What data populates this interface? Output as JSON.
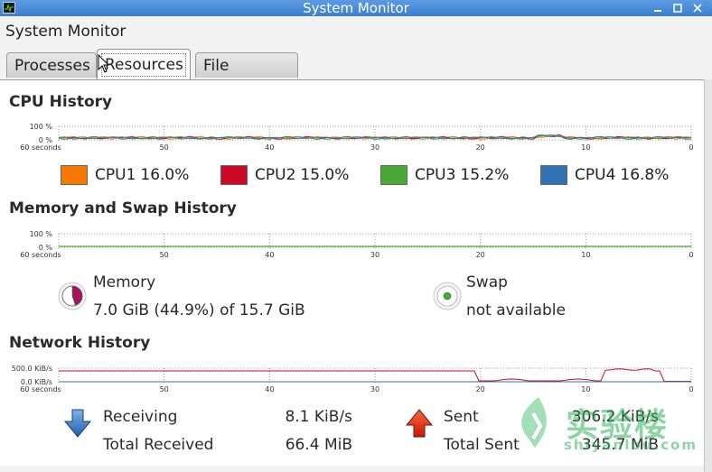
{
  "window": {
    "title": "System Monitor"
  },
  "menubar": {
    "app_name": "System Monitor"
  },
  "tabs": [
    {
      "label": "Processes",
      "active": false
    },
    {
      "label": "Resources",
      "active": true
    },
    {
      "label": "File Systems",
      "active": false
    }
  ],
  "cpu": {
    "title": "CPU History",
    "y_labels": [
      "100 %",
      "0 %"
    ],
    "x_labels": [
      "60 seconds",
      "50",
      "40",
      "30",
      "20",
      "10",
      "0"
    ],
    "legend": [
      {
        "name": "CPU1",
        "value": "16.0%",
        "color": "#f57900"
      },
      {
        "name": "CPU2",
        "value": "15.0%",
        "color": "#cc0a28"
      },
      {
        "name": "CPU3",
        "value": "15.2%",
        "color": "#4aa934"
      },
      {
        "name": "CPU4",
        "value": "16.8%",
        "color": "#2f72b4"
      }
    ]
  },
  "memory": {
    "title": "Memory and Swap History",
    "y_labels": [
      "100 %",
      "0 %"
    ],
    "x_labels": [
      "60 seconds",
      "50",
      "40",
      "30",
      "20",
      "10",
      "0"
    ],
    "memory_label": "Memory",
    "memory_value": "7.0 GiB (44.9%) of 15.7 GiB",
    "memory_fraction": 0.449,
    "memory_color": "#a4165c",
    "swap_label": "Swap",
    "swap_value": "not available",
    "swap_color": "#4aa934"
  },
  "network": {
    "title": "Network History",
    "y_labels": [
      "500.0 KiB/s",
      "0.0 KiB/s"
    ],
    "x_labels": [
      "60 seconds",
      "50",
      "40",
      "30",
      "20",
      "10",
      "0"
    ],
    "receiving_label": "Receiving",
    "receiving_value": "8.1 KiB/s",
    "total_received_label": "Total Received",
    "total_received_value": "66.4 MiB",
    "sent_label": "Sent",
    "sent_value": "306.2 KiB/s",
    "total_sent_label": "Total Sent",
    "total_sent_value": "345.7 MiB",
    "receiving_color": "#2f72b4",
    "sent_color": "#cc0a28"
  },
  "watermark": {
    "text_cn": "实验楼",
    "text_en": "shiyanlou.com"
  }
}
